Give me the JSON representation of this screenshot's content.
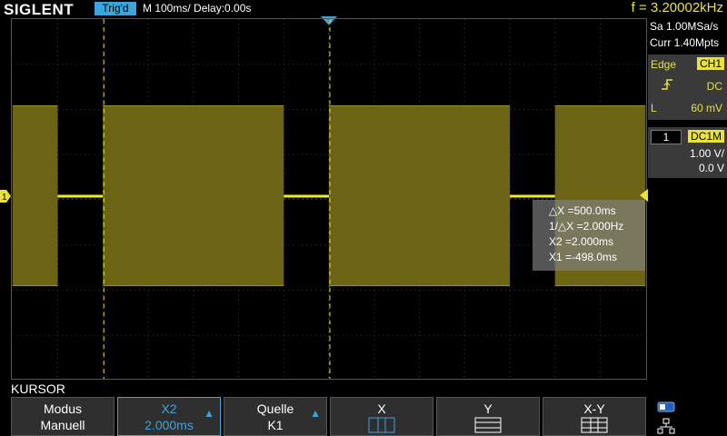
{
  "top": {
    "brand": "SIGLENT",
    "trig_status": "Trig'd",
    "timebase": "M 100ms/",
    "delay": "Delay:0.00s",
    "freq": "f = 3.20002kHz"
  },
  "acq": {
    "sa": "Sa 1.00MSa/s",
    "curr": "Curr 1.40Mpts"
  },
  "trigger": {
    "type": "Edge",
    "source": "CH1",
    "coupling": "DC",
    "level_label": "L",
    "level": "60 mV"
  },
  "channel": {
    "num": "1",
    "coupling": "DC1M",
    "vdiv": "1.00 V/",
    "offset": "0.0 V"
  },
  "measure": {
    "dx": "△X =500.0ms",
    "inv_dx": "1/△X =2.000Hz",
    "x2": "X2 =2.000ms",
    "x1": "X1 =-498.0ms"
  },
  "menu": {
    "title": "KURSOR",
    "softkeys": [
      {
        "l1": "Modus",
        "l2": "Manuell"
      },
      {
        "l1": "X2",
        "l2": "2.000ms"
      },
      {
        "l1": "Quelle",
        "l2": "K1"
      },
      {
        "l1": "X",
        "l2": ""
      },
      {
        "l1": "Y",
        "l2": ""
      },
      {
        "l1": "X-Y",
        "l2": ""
      }
    ]
  },
  "markers": {
    "ch1_label": "1"
  },
  "colors": {
    "accent": "#39a6e0",
    "trace": "#e8e23a",
    "trace_fill": "#6b6414"
  }
}
